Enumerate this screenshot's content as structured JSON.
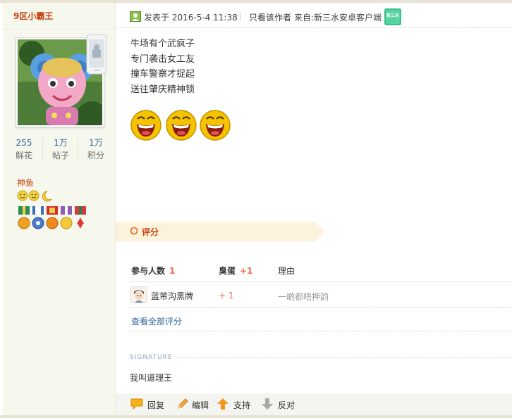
{
  "user": {
    "name": "9区小霸王",
    "stats": [
      {
        "value": "255",
        "label": "鲜花"
      },
      {
        "value": "1万",
        "label": "帖子"
      },
      {
        "value": "1万",
        "label": "积分"
      }
    ],
    "group": "神鱼"
  },
  "post": {
    "posted_prefix": "发表于",
    "timestamp": "2016-5-4 11:38",
    "separator": "|",
    "author_only": "只看该作者",
    "source": "来自:新三水安卓客户端",
    "app_icon_text": "新三水",
    "lines": [
      "牛场有个武疯子",
      "专门袭击女工友",
      "撞车警察才捉起",
      "送往肇庆精神锁"
    ]
  },
  "rating": {
    "title": "评分",
    "col_participants": "参与人数",
    "participants_count": "1",
    "col_egg": "臭蛋",
    "egg_count": "+1",
    "col_reason": "理由",
    "rows": [
      {
        "name": "蓝芾沟黑牌",
        "score": "+ 1",
        "reason": "一啲都唔押韵"
      }
    ],
    "view_all": "查看全部评分"
  },
  "signature": {
    "label": "SIGNATURE",
    "text": "我叫道理王"
  },
  "actions": {
    "reply": "回复",
    "edit": "编辑",
    "support": "支持",
    "oppose": "反对"
  },
  "colors": {
    "accent": "#c5410d",
    "link": "#336699",
    "score": "#f26c4f",
    "sidebar_bg": "#f6f8ee"
  }
}
